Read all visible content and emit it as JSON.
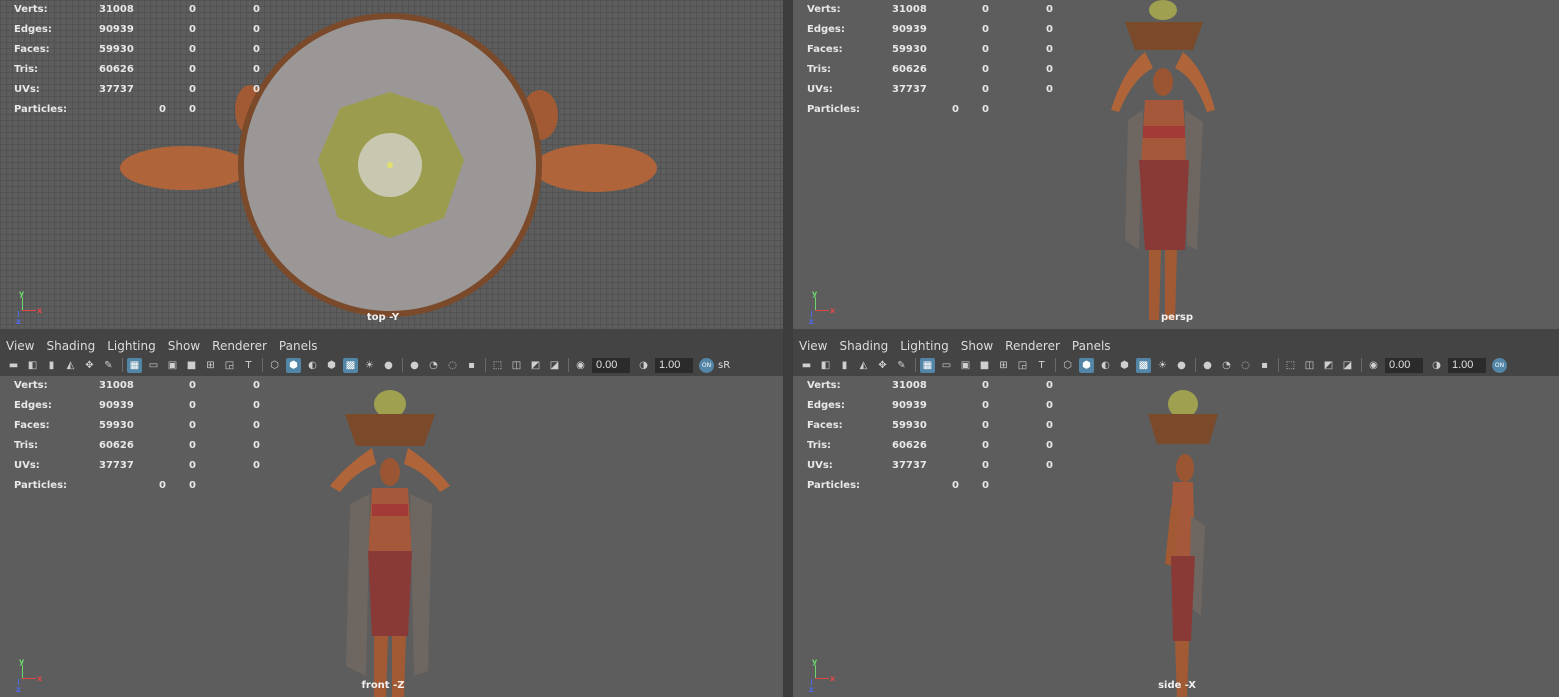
{
  "stats": {
    "rows": [
      {
        "label": "Verts:",
        "v1": "31008",
        "v2": "0",
        "v3": "0"
      },
      {
        "label": "Edges:",
        "v1": "90939",
        "v2": "0",
        "v3": "0"
      },
      {
        "label": "Faces:",
        "v1": "59930",
        "v2": "0",
        "v3": "0"
      },
      {
        "label": "Tris:",
        "v1": "60626",
        "v2": "0",
        "v3": "0"
      },
      {
        "label": "UVs:",
        "v1": "37737",
        "v2": "0",
        "v3": "0"
      }
    ],
    "particles": {
      "label": "Particles:",
      "v1": "0",
      "v2": "0"
    }
  },
  "viewports": {
    "top": {
      "camera": "top -Y"
    },
    "persp": {
      "camera": "persp"
    },
    "front": {
      "camera": "front -Z"
    },
    "side": {
      "camera": "side -X"
    }
  },
  "axes": {
    "x": "x",
    "y": "y",
    "z": "z"
  },
  "menu": [
    "View",
    "Shading",
    "Lighting",
    "Show",
    "Renderer",
    "Panels"
  ],
  "toolbar": {
    "exposure": "0.00",
    "gamma": "1.00",
    "on_label": "ON",
    "color_space": "sR"
  },
  "colors": {
    "viewport_bg": "#5d5d5d",
    "panel_bg": "#444444",
    "active_icon": "#5285a6",
    "skin": "#b0643a",
    "basket": "#7a4a2a",
    "pot": "#9fa050"
  }
}
